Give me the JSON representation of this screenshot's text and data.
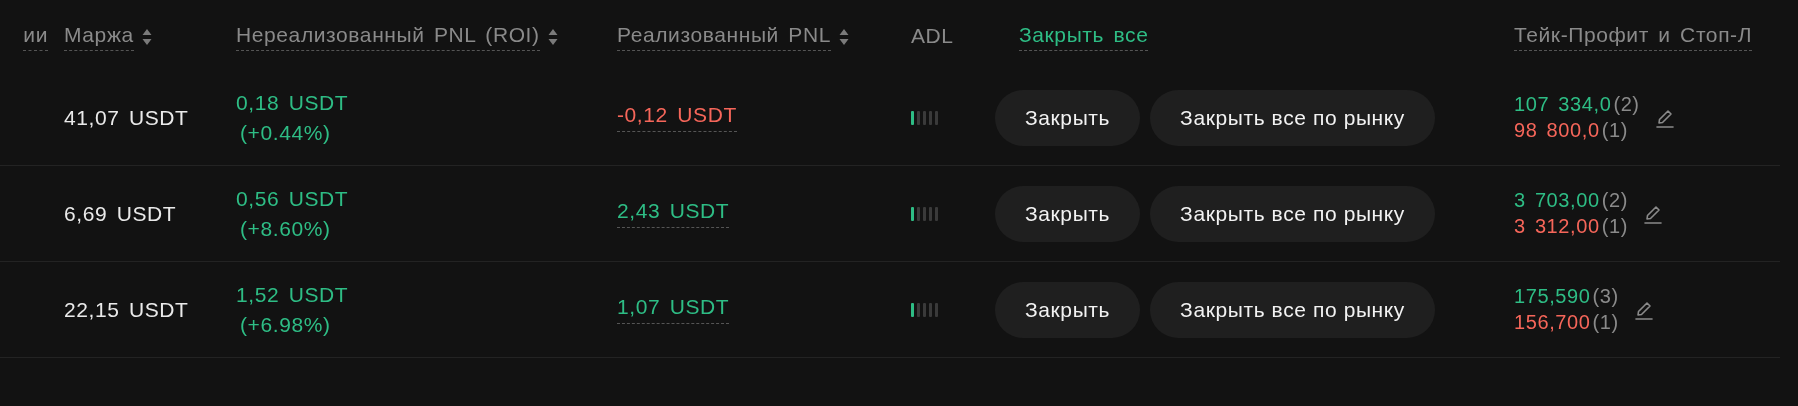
{
  "table": {
    "columns": [
      {
        "label": "ии",
        "sortable": false,
        "kind": "plain"
      },
      {
        "label": "Маржа",
        "sortable": true,
        "kind": "plain"
      },
      {
        "label": "Нереализованный PNL (ROI)",
        "sortable": true,
        "kind": "plain"
      },
      {
        "label": "Реализованный PNL",
        "sortable": true,
        "kind": "plain"
      },
      {
        "label": "ADL",
        "sortable": false,
        "kind": "noline"
      },
      {
        "label": "Закрыть все",
        "sortable": false,
        "kind": "action"
      },
      {
        "label": "Тейк-Профит и Стоп-Л",
        "sortable": false,
        "kind": "plain"
      }
    ],
    "rows": [
      {
        "margin": "41,07 USDT",
        "unrealized": {
          "value": "0,18 USDT",
          "roi": "(+0.44%)",
          "kind": "profit"
        },
        "realized": {
          "value": "-0,12 USDT",
          "kind": "loss"
        },
        "adl": {
          "level": 0.2
        },
        "close_label": "Закрыть",
        "close_market_label": "Закрыть все по рынку",
        "tp": "107 334,0",
        "tp_count": "(2)",
        "sl": "98 800,0",
        "sl_count": "(1)"
      },
      {
        "margin": "6,69 USDT",
        "unrealized": {
          "value": "0,56 USDT",
          "roi": "(+8.60%)",
          "kind": "profit"
        },
        "realized": {
          "value": "2,43 USDT",
          "kind": "profit"
        },
        "adl": {
          "level": 0.2
        },
        "close_label": "Закрыть",
        "close_market_label": "Закрыть все по рынку",
        "tp": "3 703,00",
        "tp_count": "(2)",
        "sl": "3 312,00",
        "sl_count": "(1)"
      },
      {
        "margin": "22,15 USDT",
        "unrealized": {
          "value": "1,52 USDT",
          "roi": "(+6.98%)",
          "kind": "profit"
        },
        "realized": {
          "value": "1,07 USDT",
          "kind": "profit"
        },
        "adl": {
          "level": 0.2
        },
        "close_label": "Закрыть",
        "close_market_label": "Закрыть все по рынку",
        "tp": "175,590",
        "tp_count": "(3)",
        "sl": "156,700",
        "sl_count": "(1)"
      }
    ]
  }
}
